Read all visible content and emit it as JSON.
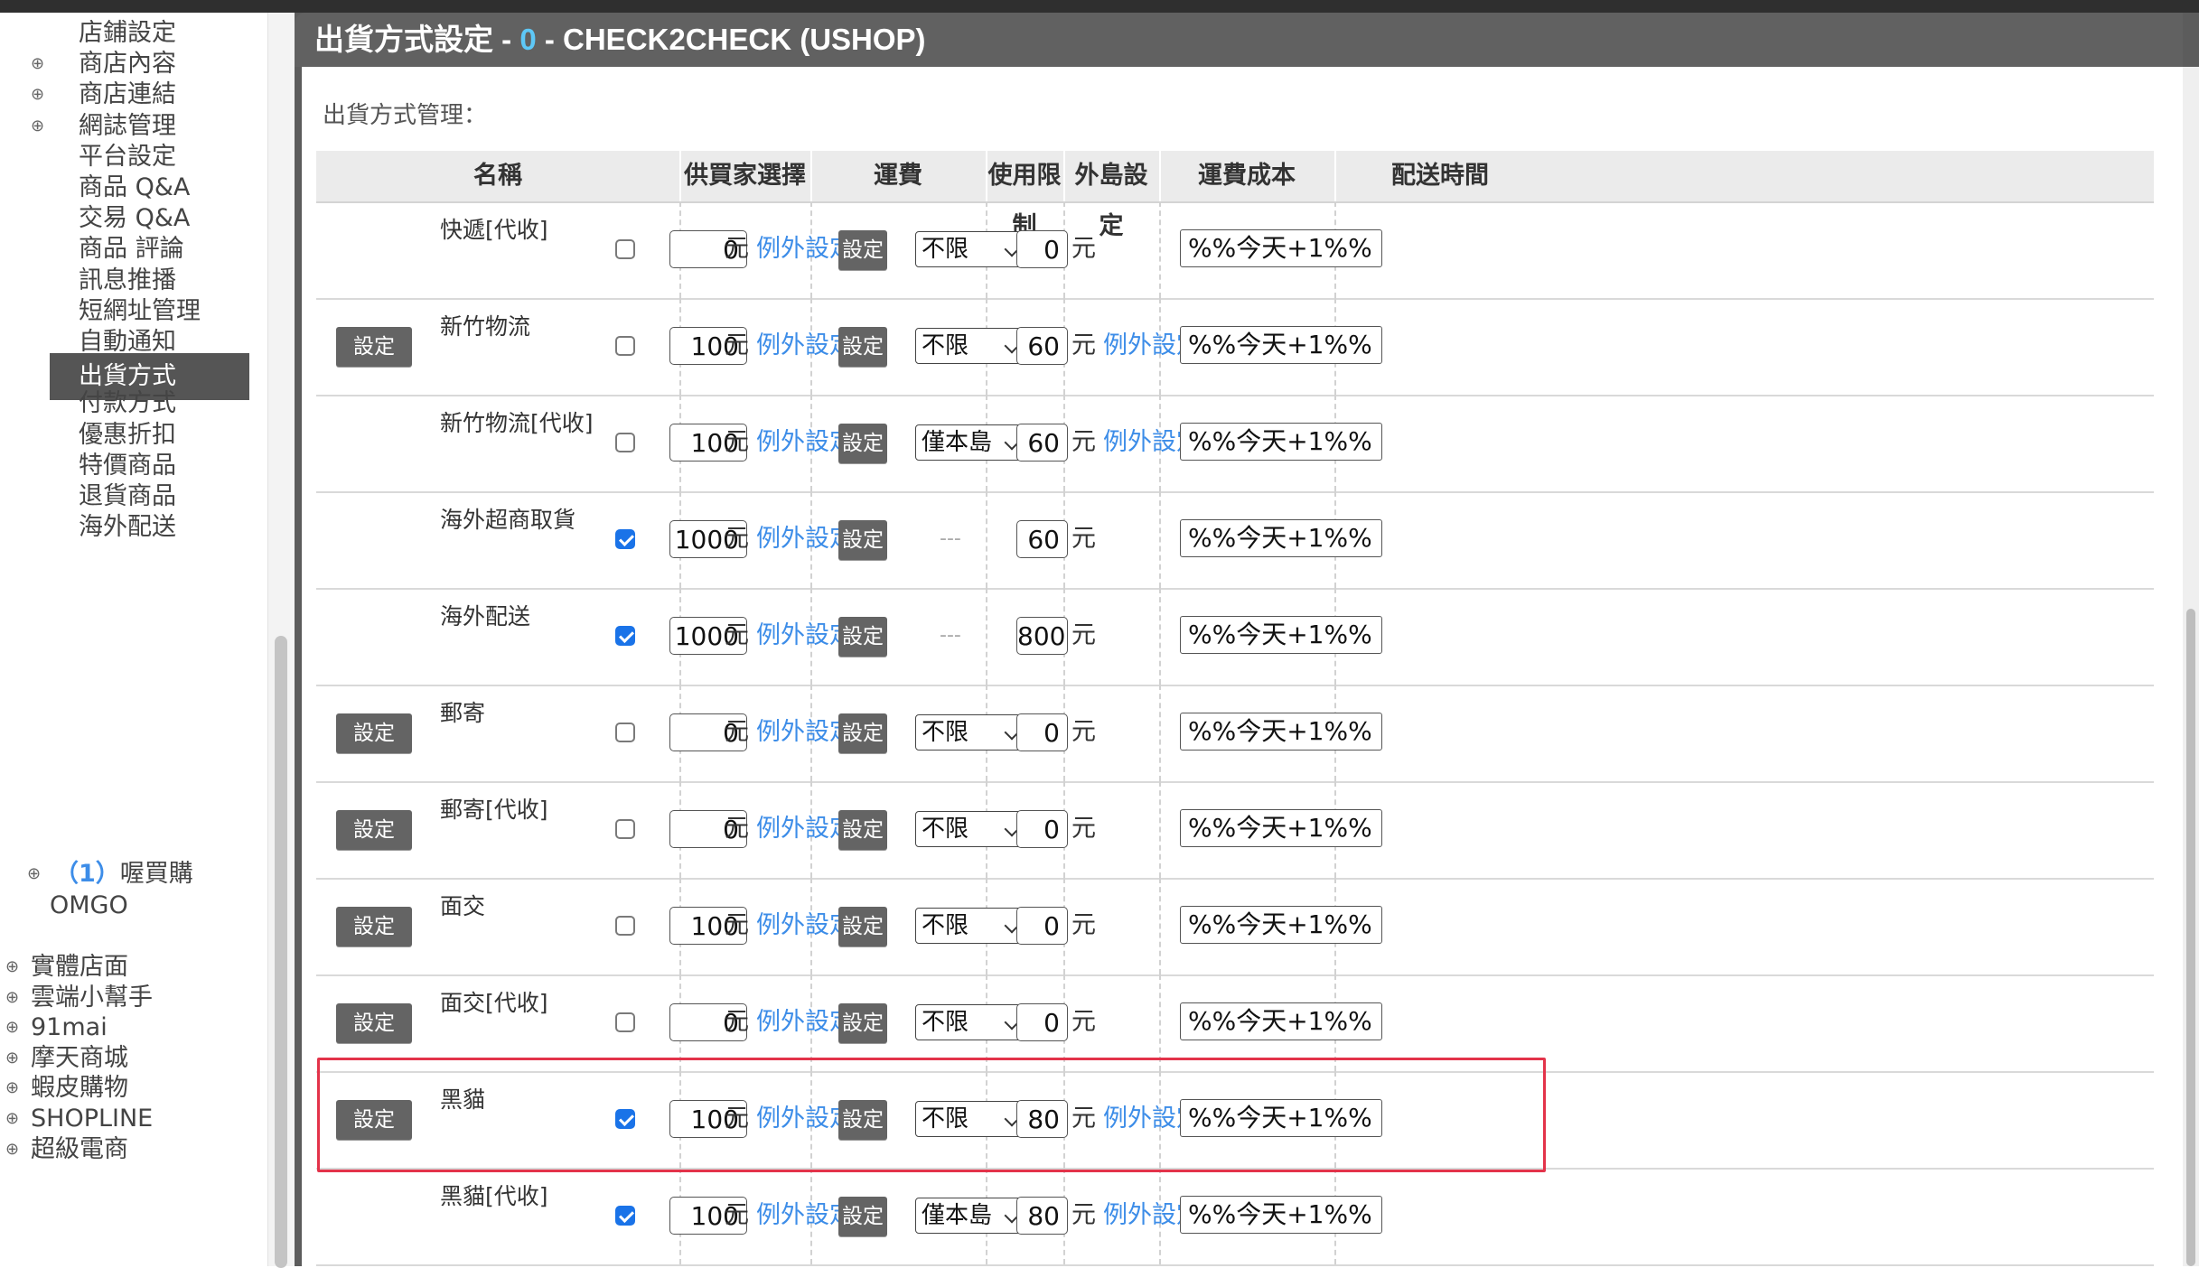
{
  "sidebar": {
    "items": [
      {
        "label": "店鋪設定",
        "expandable": false,
        "active": false
      },
      {
        "label": "商店內容",
        "expandable": true,
        "active": false
      },
      {
        "label": "商店連結",
        "expandable": true,
        "active": false
      },
      {
        "label": "網誌管理",
        "expandable": true,
        "active": false
      },
      {
        "label": "平台設定",
        "expandable": false,
        "active": false
      },
      {
        "label": "商品 Q&A",
        "expandable": false,
        "active": false
      },
      {
        "label": "交易 Q&A",
        "expandable": false,
        "active": false
      },
      {
        "label": "商品 評論",
        "expandable": false,
        "active": false
      },
      {
        "label": "訊息推播",
        "expandable": false,
        "active": false
      },
      {
        "label": "短網址管理",
        "expandable": false,
        "active": false
      },
      {
        "label": "自動通知",
        "expandable": false,
        "active": false
      },
      {
        "label": "出貨方式",
        "expandable": false,
        "active": true
      },
      {
        "label": "付款方式",
        "expandable": false,
        "active": false
      },
      {
        "label": "優惠折扣",
        "expandable": false,
        "active": false
      },
      {
        "label": "特價商品",
        "expandable": false,
        "active": false
      },
      {
        "label": "退貨商品",
        "expandable": false,
        "active": false
      },
      {
        "label": "海外配送",
        "expandable": false,
        "active": false
      }
    ],
    "omgo": {
      "count": "（1）",
      "label": "喔買購",
      "sub": "OMGO"
    },
    "groups": [
      {
        "label": "實體店面"
      },
      {
        "label": "雲端小幫手"
      },
      {
        "label": "91mai"
      },
      {
        "label": "摩天商城"
      },
      {
        "label": "蝦皮購物"
      },
      {
        "label": "SHOPLINE"
      },
      {
        "label": "超級電商"
      }
    ]
  },
  "header": {
    "prefix": "出貨方式設定 - ",
    "count": "0",
    "suffix": " - CHECK2CHECK (USHOP)"
  },
  "section_label": "出貨方式管理：",
  "columns": {
    "name": "名稱",
    "buyer_choice": "供買家選擇",
    "fee": "運費",
    "limit": "使用限制",
    "island": "外島設定",
    "cost": "運費成本",
    "delivery": "配送時間"
  },
  "labels": {
    "settings": "設定",
    "unit": "元",
    "exception": "例外設定",
    "dash": "---"
  },
  "rows": [
    {
      "name": "快遞[代收]",
      "has_settings": false,
      "checked": false,
      "fee": "0",
      "island": "不限",
      "cost": "0",
      "cost_exception": false,
      "delivery": "%%今天+1%%"
    },
    {
      "name": "新竹物流",
      "has_settings": true,
      "checked": false,
      "fee": "100",
      "island": "不限",
      "cost": "60",
      "cost_exception": true,
      "delivery": "%%今天+1%%"
    },
    {
      "name": "新竹物流[代收]",
      "has_settings": false,
      "checked": false,
      "fee": "100",
      "island": "僅本島",
      "cost": "60",
      "cost_exception": true,
      "delivery": "%%今天+1%%"
    },
    {
      "name": "海外超商取貨",
      "has_settings": false,
      "checked": true,
      "fee": "1000",
      "island": null,
      "cost": "60",
      "cost_exception": false,
      "delivery": "%%今天+1%%"
    },
    {
      "name": "海外配送",
      "has_settings": false,
      "checked": true,
      "fee": "1000",
      "island": null,
      "cost": "800",
      "cost_exception": false,
      "delivery": "%%今天+1%%"
    },
    {
      "name": "郵寄",
      "has_settings": true,
      "checked": false,
      "fee": "0",
      "island": "不限",
      "cost": "0",
      "cost_exception": false,
      "delivery": "%%今天+1%%"
    },
    {
      "name": "郵寄[代收]",
      "has_settings": true,
      "checked": false,
      "fee": "0",
      "island": "不限",
      "cost": "0",
      "cost_exception": false,
      "delivery": "%%今天+1%%"
    },
    {
      "name": "面交",
      "has_settings": true,
      "checked": false,
      "fee": "100",
      "island": "不限",
      "cost": "0",
      "cost_exception": false,
      "delivery": "%%今天+1%%"
    },
    {
      "name": "面交[代收]",
      "has_settings": true,
      "checked": false,
      "fee": "0",
      "island": "不限",
      "cost": "0",
      "cost_exception": false,
      "delivery": "%%今天+1%%"
    },
    {
      "name": "黑貓",
      "has_settings": true,
      "checked": true,
      "fee": "100",
      "island": "不限",
      "cost": "80",
      "cost_exception": true,
      "delivery": "%%今天+1%%",
      "highlighted": true
    },
    {
      "name": "黑貓[代收]",
      "has_settings": false,
      "checked": true,
      "fee": "100",
      "island": "僅本島",
      "cost": "80",
      "cost_exception": true,
      "delivery": "%%今天+1%%"
    }
  ],
  "colors": {
    "accent_blue": "#3d8de8",
    "header_gray": "#616161",
    "active_item": "#555555",
    "highlight_red": "#e3334a",
    "checkbox_blue": "#1a73e8"
  }
}
